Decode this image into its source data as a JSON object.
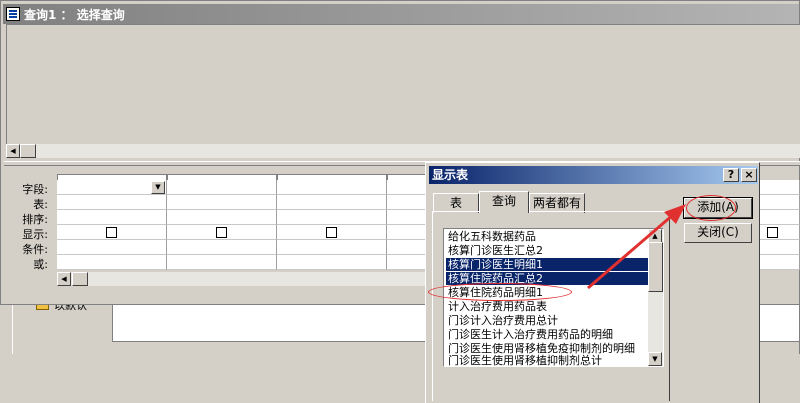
{
  "query_window": {
    "title": "查询1 ： 选择查询"
  },
  "grid": {
    "row_labels": [
      "字段:",
      "表:",
      "排序:",
      "显示:",
      "条件:",
      "或:"
    ]
  },
  "background_item": {
    "label": "以默认"
  },
  "dialog": {
    "title": "显示表",
    "help_button": "?",
    "close_button": "×",
    "tabs": [
      "表",
      "查询",
      "两者都有"
    ],
    "active_tab": "查询",
    "list_items": [
      "给化五科数据药品",
      "核算门诊医生汇总2",
      "核算门诊医生明细1",
      "核算住院药品汇总2",
      "核算住院药品明细1",
      "计入治疗费用药品表",
      "门诊计入治疗费用总计",
      "门诊医生计入治疗费用药品的明细",
      "门诊医生使用肾移植免疫抑制剂的明细",
      "门诊医生使用肾移植抑制剂总计"
    ],
    "selected_items": [
      2,
      3
    ],
    "add_button": "添加(A)",
    "close_button_label": "关闭(C)"
  },
  "colors": {
    "selection": "#0a246a",
    "annotation": "#e03030",
    "window_face": "#d4d0c8"
  }
}
